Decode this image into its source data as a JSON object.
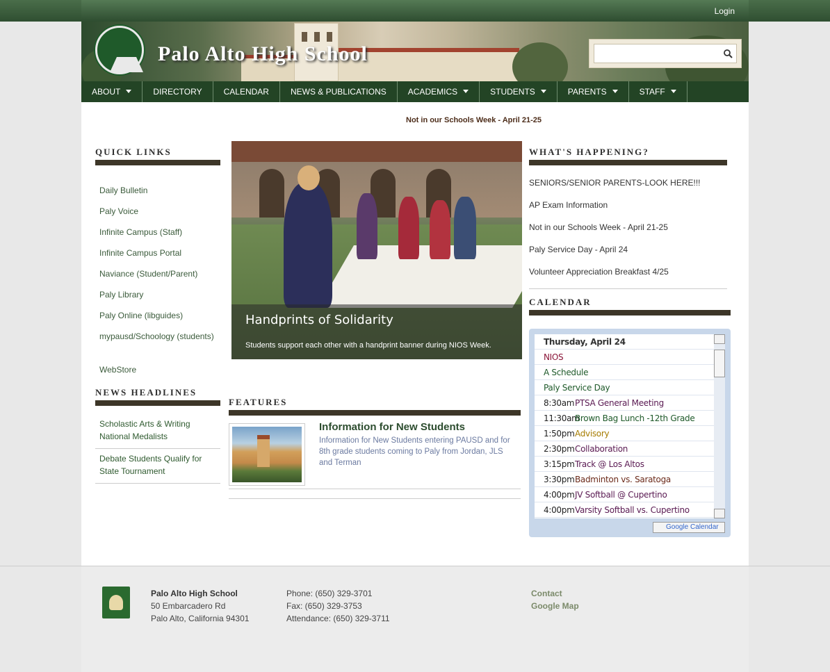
{
  "header": {
    "login_label": "Login",
    "school_name": "Palo Alto High School",
    "search_placeholder": ""
  },
  "nav": {
    "items": [
      {
        "label": "ABOUT",
        "has_menu": true
      },
      {
        "label": "DIRECTORY",
        "has_menu": false
      },
      {
        "label": "CALENDAR",
        "has_menu": false
      },
      {
        "label": "NEWS & PUBLICATIONS",
        "has_menu": false
      },
      {
        "label": "ACADEMICS",
        "has_menu": true
      },
      {
        "label": "STUDENTS",
        "has_menu": true
      },
      {
        "label": "PARENTS",
        "has_menu": true
      },
      {
        "label": "STAFF",
        "has_menu": true
      }
    ]
  },
  "announcement": "Not in our Schools Week - April 21-25",
  "quick_links": {
    "title": "QUICK LINKS",
    "items": [
      "Daily Bulletin",
      "Paly Voice",
      "Infinite Campus (Staff)",
      "Infinite Campus Portal",
      "Naviance (Student/Parent)",
      "Paly Library",
      "Paly Online (libguides)",
      "mypausd/Schoology (students)",
      "WebStore"
    ]
  },
  "news_headlines": {
    "title": "NEWS HEADLINES",
    "items": [
      "Scholastic Arts & Writing National Medalists",
      "Debate Students Qualify for State Tournament"
    ]
  },
  "slideshow": {
    "caption_title": "Handprints of Solidarity",
    "caption_text": "Students support each other with a handprint banner during NIOS Week."
  },
  "features": {
    "title": "FEATURES",
    "items": [
      {
        "title": "Information for New Students",
        "description": "Information for New Students entering PAUSD and for 8th grade students coming to Paly from Jordan, JLS and Terman"
      }
    ]
  },
  "whats_happening": {
    "title": "WHAT'S HAPPENING?",
    "items": [
      "SENIORS/SENIOR PARENTS-LOOK HERE!!!",
      "AP Exam Information",
      "Not in our Schools Week - April 21-25",
      "Paly Service Day - April 24",
      "Volunteer Appreciation Breakfast 4/25"
    ]
  },
  "calendar": {
    "title": "CALENDAR",
    "day": "Thursday, April 24",
    "all_day": [
      {
        "title": "NIOS",
        "color": "#8a1538"
      },
      {
        "title": "A Schedule",
        "color": "#1f5a2a"
      },
      {
        "title": "Paly Service Day",
        "color": "#1f5a2a"
      }
    ],
    "events": [
      {
        "time": "8:30am",
        "title": "PTSA General Meeting",
        "color": "#5a1a52"
      },
      {
        "time": "11:30am",
        "title": "Brown Bag Lunch -12th Grade",
        "color": "#1f5a2a"
      },
      {
        "time": "1:50pm",
        "title": "Advisory",
        "color": "#a67c00"
      },
      {
        "time": "2:30pm",
        "title": "Collaboration",
        "color": "#5a1a52"
      },
      {
        "time": "3:15pm",
        "title": "Track @ Los Altos",
        "color": "#5a1a52"
      },
      {
        "time": "3:30pm",
        "title": "Badminton vs. Saratoga",
        "color": "#6b2a1a"
      },
      {
        "time": "4:00pm",
        "title": "JV Softball @ Cupertino",
        "color": "#5a1a52"
      },
      {
        "time": "4:00pm",
        "title": "Varsity Softball vs. Cupertino",
        "color": "#5a1a52"
      }
    ],
    "google_button": "Google Calendar"
  },
  "footer": {
    "school": "Palo Alto High School",
    "address1": "50 Embarcadero Rd",
    "address2": "Palo Alto, California 94301",
    "phone": "Phone: (650) 329-3701",
    "fax": "Fax: (650) 329-3753",
    "attendance": "Attendance: (650) 329-3711",
    "link1": "Contact",
    "link2": "Google Map"
  },
  "colors": {
    "nav_bg": "#234425",
    "accent_bar": "#3d3628",
    "link_green": "#3a5a3a"
  }
}
